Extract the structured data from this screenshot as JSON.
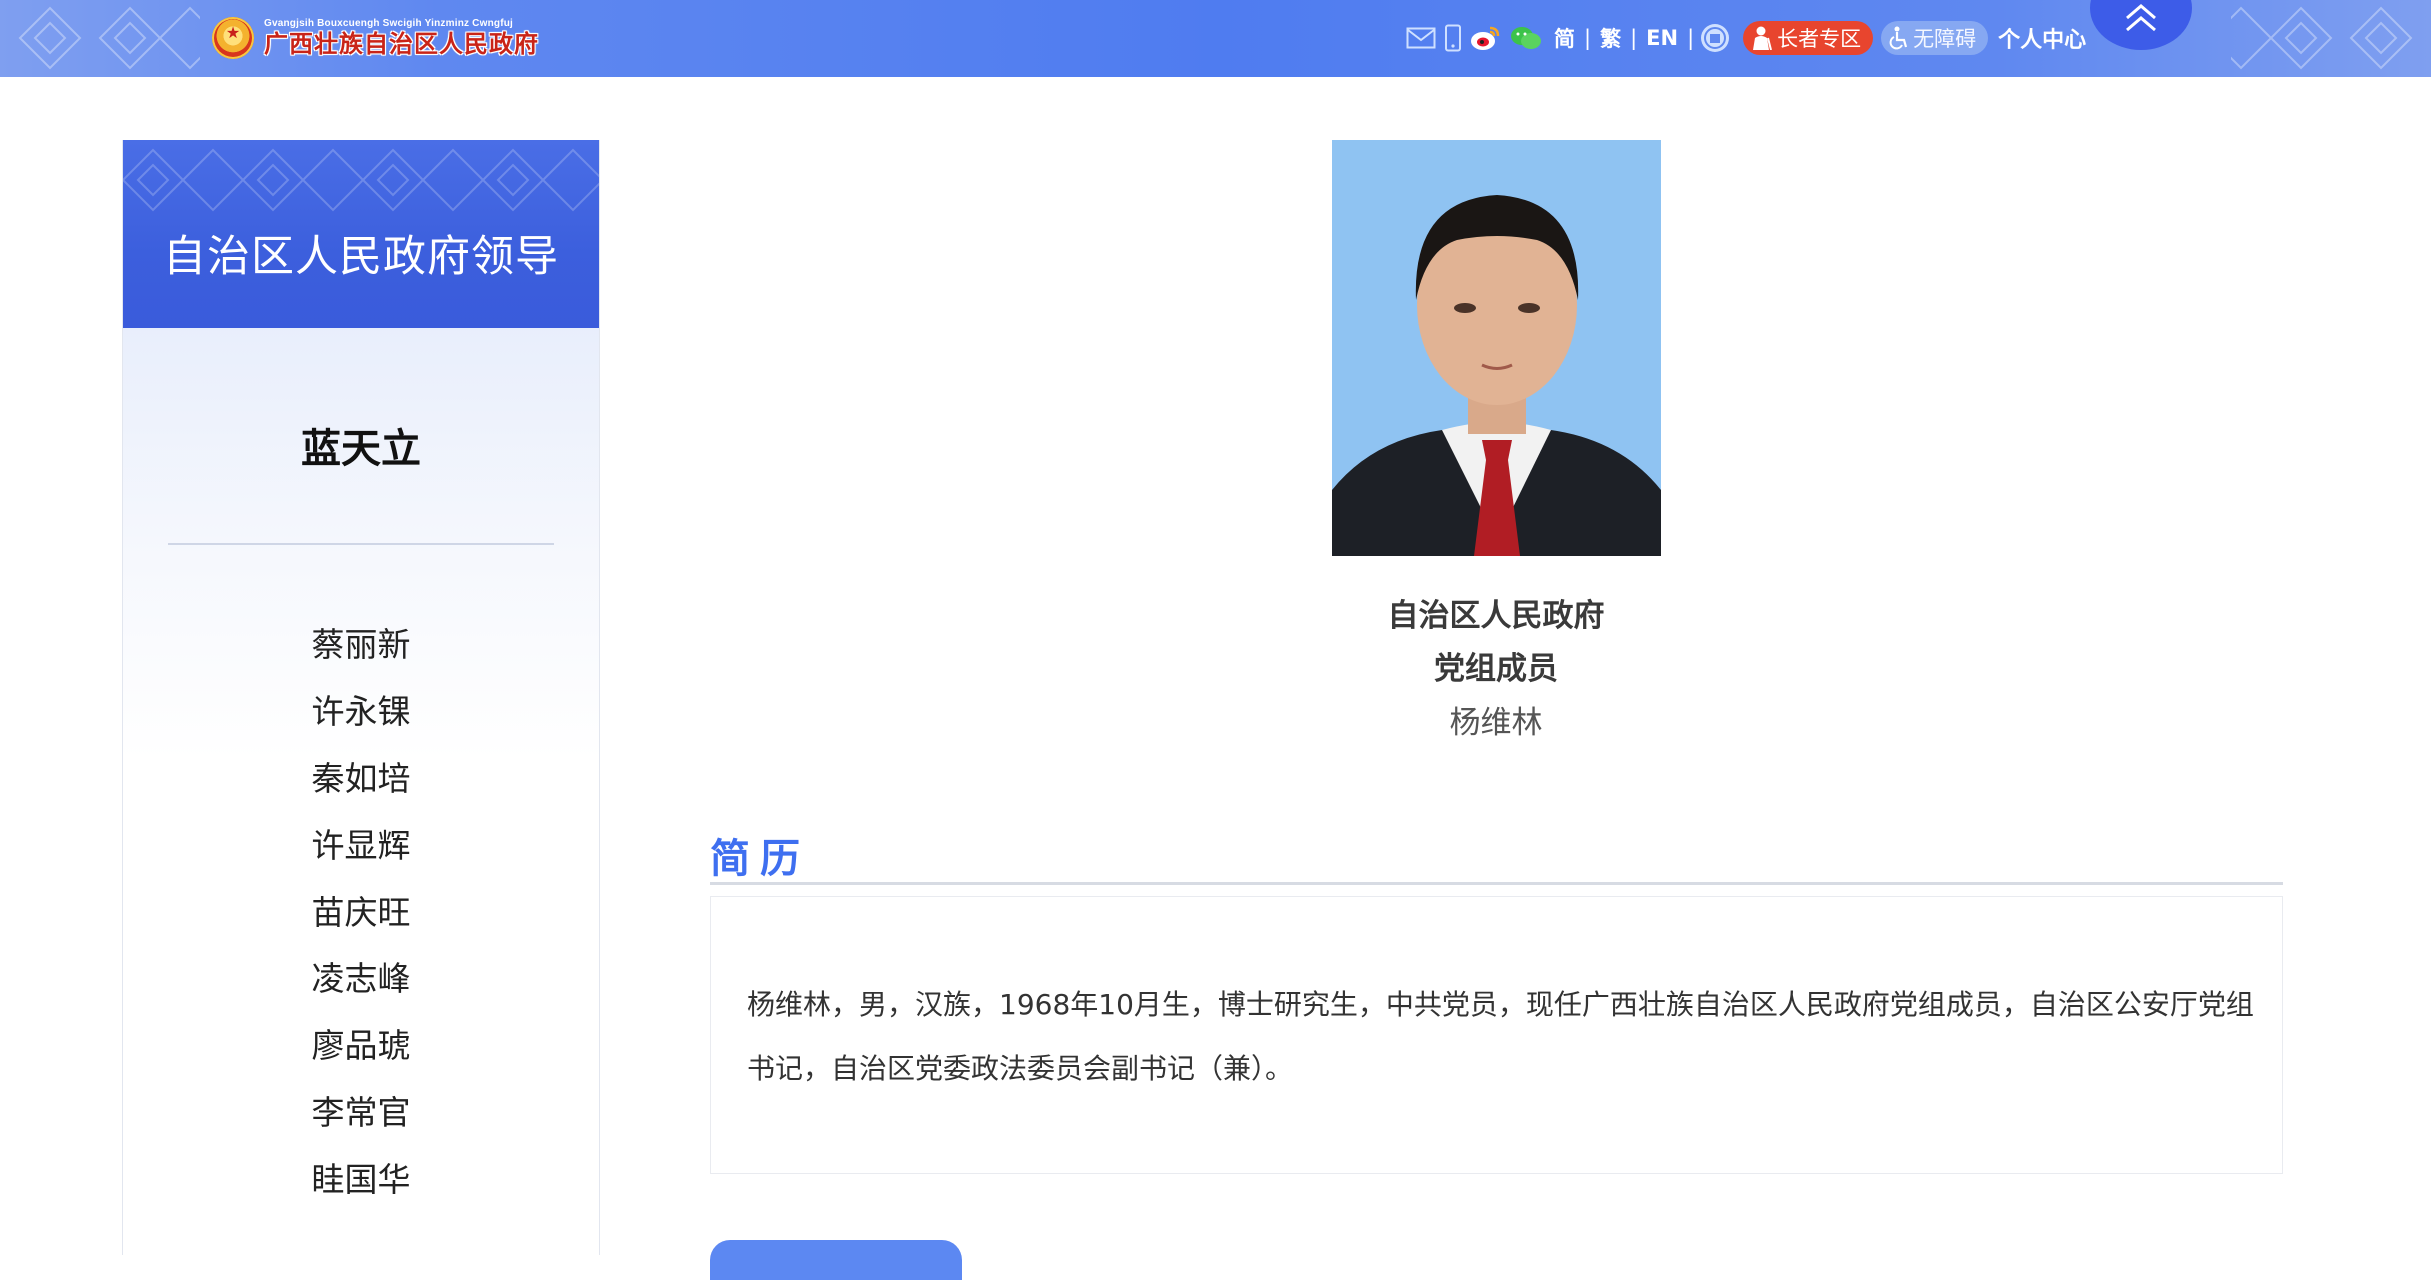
{
  "header": {
    "logo_latin": "Gvangjsih Bouxcuengh Swcigih Yinzminz Cwngfuj",
    "logo_cn": "广西壮族自治区人民政府",
    "icons": [
      "mail-icon",
      "mobile-icon",
      "weibo-icon",
      "wechat-icon"
    ],
    "lang_simplified": "简",
    "lang_traditional": "繁",
    "lang_english": "EN",
    "elder_zone": "长者专区",
    "accessibility": "无障碍",
    "personal_center": "个人中心"
  },
  "sidebar": {
    "title": "自治区人民政府领导",
    "current": "蓝天立",
    "items": [
      {
        "label": "蔡丽新"
      },
      {
        "label": "许永锞"
      },
      {
        "label": "秦如培"
      },
      {
        "label": "许显辉"
      },
      {
        "label": "苗庆旺"
      },
      {
        "label": "凌志峰"
      },
      {
        "label": "廖品琥"
      },
      {
        "label": "李常官"
      },
      {
        "label": "眭国华"
      }
    ]
  },
  "profile": {
    "role_line1": "自治区人民政府",
    "role_line2": "党组成员",
    "name": "杨维林"
  },
  "bio": {
    "section_title": "简历",
    "text": "杨维林，男，汉族，1968年10月生，博士研究生，中共党员，现任广西壮族自治区人民政府党组成员，自治区公安厅党组书记，自治区党委政法委员会副书记（兼）。"
  },
  "colors": {
    "topbar": "#5f88f0",
    "sidebar_header": "#3c5fdd",
    "section_title": "#3e6ff0",
    "elder_pill": "#e8452e",
    "access_pill": "#86a8f2"
  }
}
